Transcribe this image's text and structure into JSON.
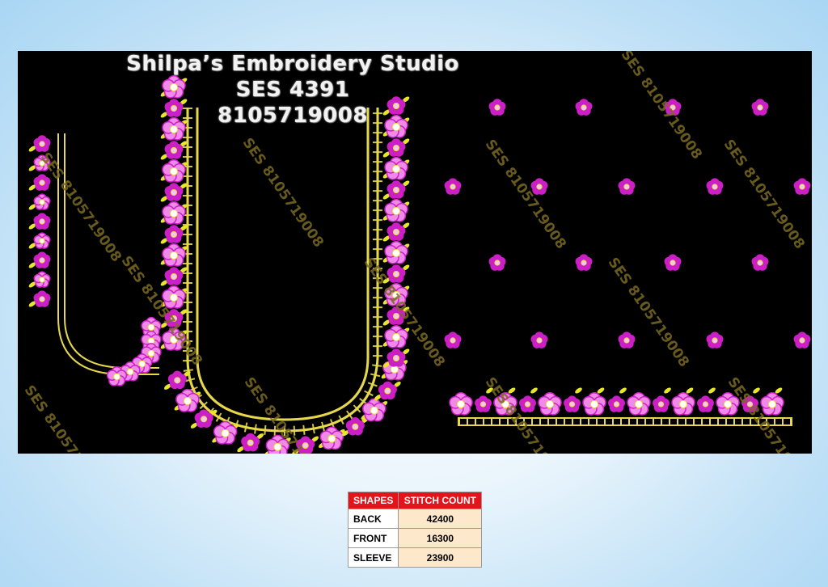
{
  "studio": {
    "name": "Shilpa’s Embroidery Studio",
    "code": "SES  4391",
    "phone": "8105719008"
  },
  "watermark": "SES 8105719008",
  "colors": {
    "background": "#000000",
    "thread_gold": "#e6d84a",
    "flower_magenta": "#cc1fc6",
    "flower_pink": "#f08ae8",
    "leaf_yellow": "#e6e62a",
    "table_header": "#e3141c"
  },
  "table": {
    "headers": [
      "SHAPES",
      "STITCH COUNT"
    ],
    "rows": [
      {
        "shape": "BACK",
        "count": "42400"
      },
      {
        "shape": "FRONT",
        "count": "16300"
      },
      {
        "shape": "SLEEVE",
        "count": "23900"
      }
    ]
  }
}
